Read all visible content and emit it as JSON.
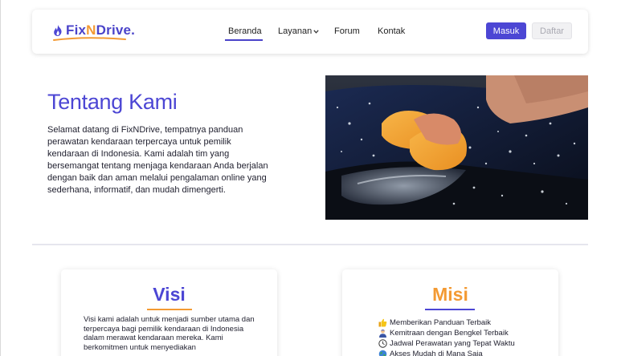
{
  "brand": {
    "name_part1": "Fix",
    "name_part2": "N",
    "name_part3": "Drive."
  },
  "nav": {
    "items": [
      {
        "label": "Beranda",
        "active": true
      },
      {
        "label": "Layanan",
        "dropdown": true
      },
      {
        "label": "Forum"
      },
      {
        "label": "Kontak"
      }
    ],
    "login_label": "Masuk",
    "register_label": "Daftar"
  },
  "about": {
    "title": "Tentang Kami",
    "text": "Selamat datang di FixNDrive, tempatnya panduan perawatan kendaraan terpercaya untuk pemilik kendaraan di Indonesia. Kami adalah tim yang bersemangat tentang menjaga kendaraan Anda berjalan dengan baik dan aman melalui pengalaman online yang sederhana, informatif, dan mudah dimengerti."
  },
  "visi": {
    "title": "Visi",
    "text": "Visi kami adalah untuk menjadi sumber utama dan terpercaya bagi pemilik kendaraan di Indonesia dalam merawat kendaraan mereka. Kami berkomitmen untuk menyediakan"
  },
  "misi": {
    "title": "Misi",
    "items": [
      {
        "icon": "thumbs-up-icon",
        "label": "Memberikan Panduan Terbaik"
      },
      {
        "icon": "mechanic-icon",
        "label": "Kemitraan dengan Bengkel Terbaik"
      },
      {
        "icon": "clock-icon",
        "label": "Jadwal Perawatan yang Tepat Waktu"
      },
      {
        "icon": "globe-icon",
        "label": "Akses Mudah di Mana Saja"
      }
    ]
  },
  "colors": {
    "primary": "#4c46d4",
    "accent": "#f39a33"
  }
}
